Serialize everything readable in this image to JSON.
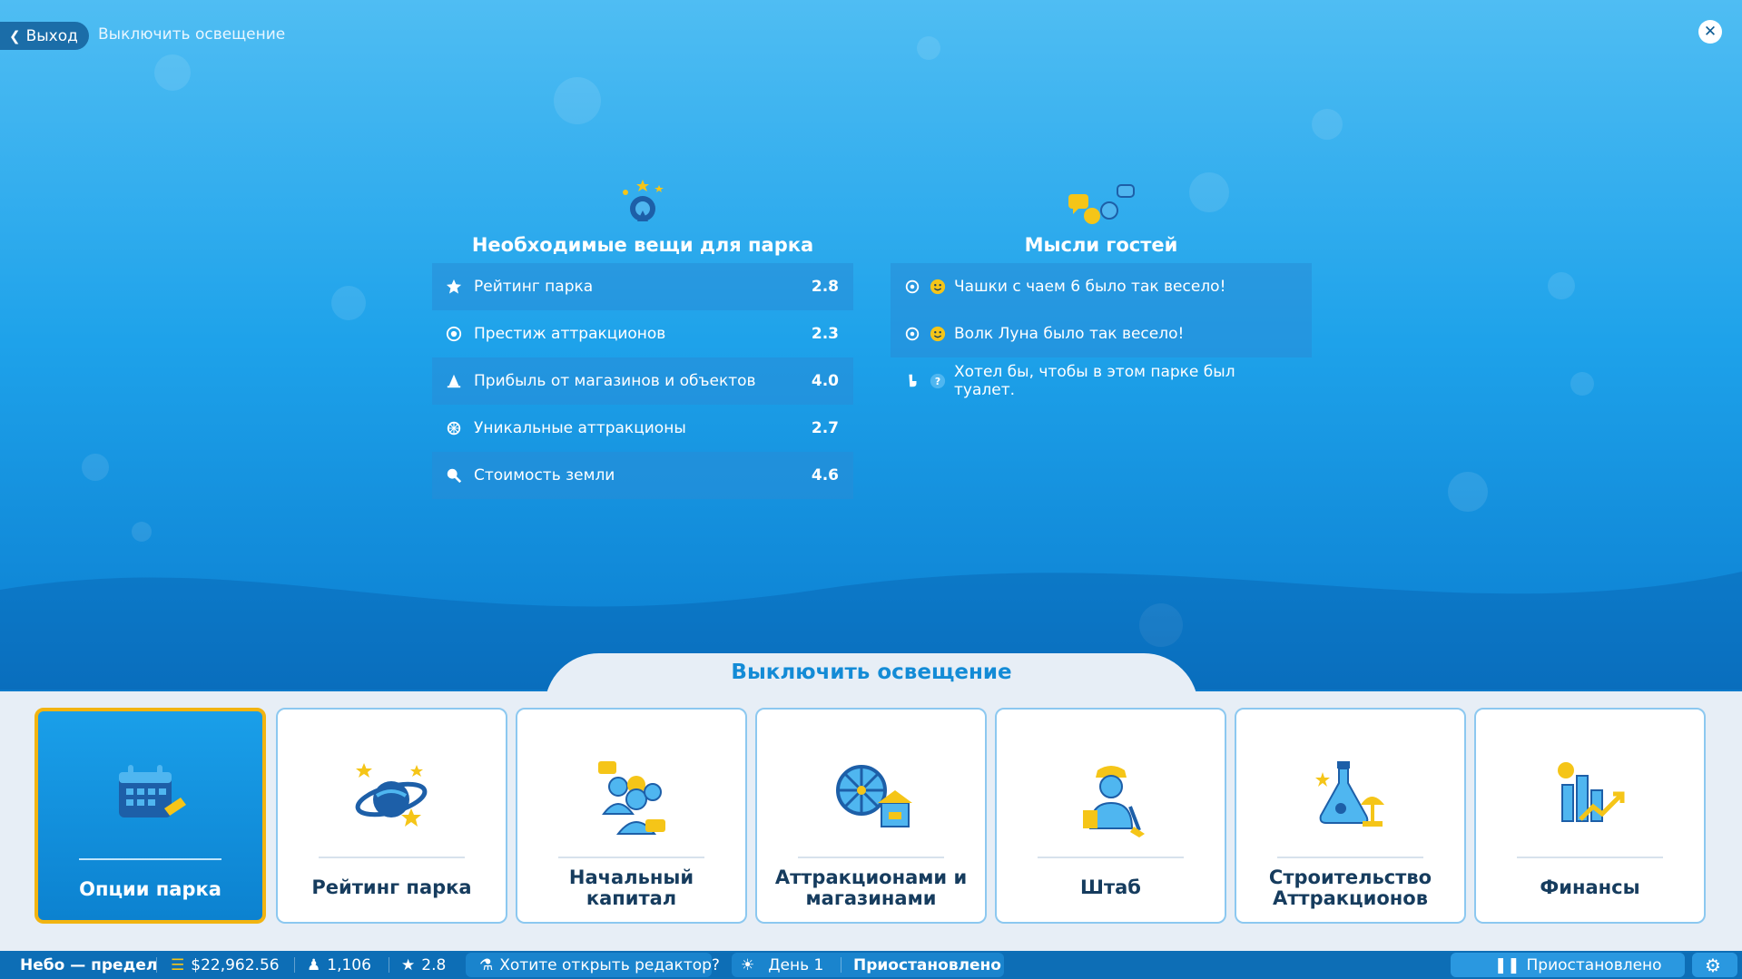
{
  "header": {
    "back_label": "Выход",
    "title": "Выключить освещение"
  },
  "park_needs": {
    "title": "Необходимые вещи для парка",
    "rows": [
      {
        "icon": "star-icon",
        "label": "Рейтинг парка",
        "value": "2.8"
      },
      {
        "icon": "prestige-icon",
        "label": "Престиж аттракционов",
        "value": "2.3"
      },
      {
        "icon": "shop-profit-icon",
        "label": "Прибыль от магазинов и объектов",
        "value": "4.0"
      },
      {
        "icon": "unique-ride-icon",
        "label": "Уникальные аттракционы",
        "value": "2.7"
      },
      {
        "icon": "land-value-icon",
        "label": "Стоимость земли",
        "value": "4.6"
      }
    ]
  },
  "guest_thoughts": {
    "title": "Мысли гостей",
    "rows": [
      {
        "icon": "ride-icon",
        "mood": "happy-face-icon",
        "text": "Чашки с чаем 6 было так весело!"
      },
      {
        "icon": "ride-icon",
        "mood": "happy-face-icon",
        "text": "Волк Луна было так весело!"
      },
      {
        "icon": "toilet-icon",
        "mood": "question-icon",
        "text": "Хотел бы, чтобы в этом парке был туалет."
      }
    ]
  },
  "bottom": {
    "title": "Выключить освещение",
    "cards": [
      {
        "label": "Опции парка",
        "icon": "calendar-icon",
        "active": true
      },
      {
        "label": "Рейтинг парка",
        "icon": "planet-stars-icon",
        "active": false
      },
      {
        "label": "Начальный капитал",
        "icon": "guests-icon",
        "active": false
      },
      {
        "label": "Аттракционами и магазинами",
        "icon": "ferris-shop-icon",
        "active": false
      },
      {
        "label": "Штаб",
        "icon": "staff-icon",
        "active": false
      },
      {
        "label": "Строительство Аттракционов",
        "icon": "research-icon",
        "active": false
      },
      {
        "label": "Финансы",
        "icon": "finance-chart-icon",
        "active": false
      }
    ]
  },
  "statusbar": {
    "park_name": "Небо — предел",
    "money": "$22,962.56",
    "guests": "1,106",
    "rating": "2.8",
    "editor_prompt": "Хотите открыть редактор?",
    "day": "День 1",
    "state": "Приостановлено",
    "pause_label": "Приостановлено"
  },
  "colors": {
    "accent": "#138bd6",
    "active_border": "#f2b411",
    "icon_yellow": "#f5c518",
    "icon_blue": "#1d5fa8"
  }
}
